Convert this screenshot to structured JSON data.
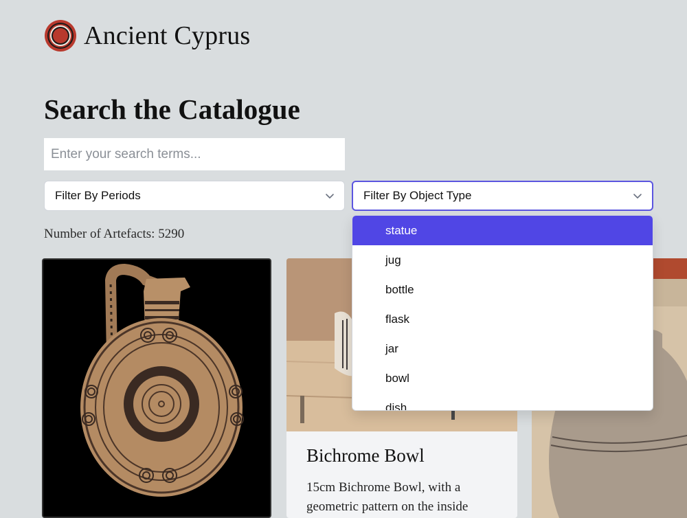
{
  "brand": {
    "name": "Ancient Cyprus",
    "logo_icon": "concentric-circles-logo-icon"
  },
  "page": {
    "title": "Search the Catalogue"
  },
  "search": {
    "placeholder": "Enter your search terms..."
  },
  "filters": {
    "periods": {
      "label": "Filter By Periods",
      "icon": "chevron-down-icon"
    },
    "object_type": {
      "label": "Filter By Object Type",
      "icon": "chevron-down-icon",
      "options": [
        "statue",
        "jug",
        "bottle",
        "flask",
        "jar",
        "bowl",
        "dish"
      ],
      "highlighted": "statue"
    }
  },
  "results": {
    "count_label": "Number of Artefacts: 5290"
  },
  "cards": [
    {
      "image": "bichrome-jug-photo"
    },
    {
      "image": "bowl-on-shelf-photo",
      "title": "Bichrome Bowl",
      "description": "15cm Bichrome Bowl, with a geometric pattern on the inside"
    },
    {
      "image": "clay-jar-photo"
    }
  ],
  "colors": {
    "background": "#d9dddf",
    "accent": "#5046e5",
    "logo_red": "#b8392d"
  }
}
